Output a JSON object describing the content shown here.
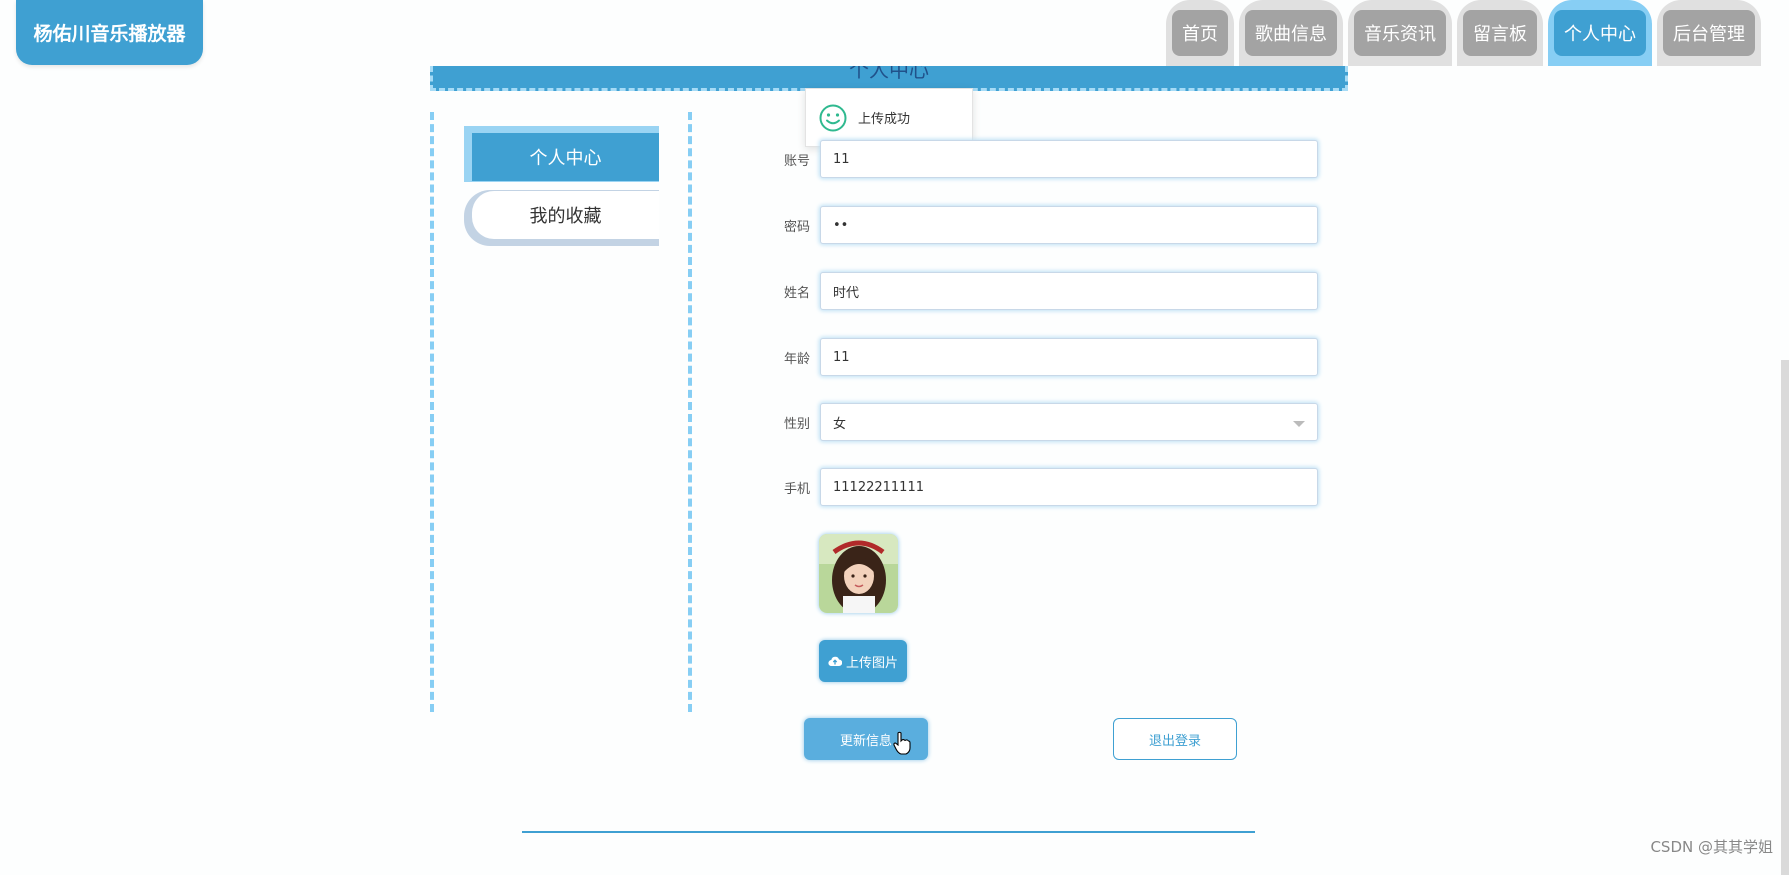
{
  "app": {
    "title": "杨佑川音乐播放器"
  },
  "nav": {
    "items": [
      {
        "label": "首页"
      },
      {
        "label": "歌曲信息"
      },
      {
        "label": "音乐资讯"
      },
      {
        "label": "留言板"
      },
      {
        "label": "个人中心",
        "active": true
      },
      {
        "label": "后台管理"
      }
    ]
  },
  "page": {
    "title": "个人中心"
  },
  "sidebar": {
    "items": [
      {
        "label": "个人中心",
        "active": true
      },
      {
        "label": "我的收藏"
      }
    ]
  },
  "toast": {
    "message": "上传成功",
    "icon": "smile-icon"
  },
  "form": {
    "account": {
      "label": "账号",
      "value": "11"
    },
    "password": {
      "label": "密码",
      "value": "••"
    },
    "name": {
      "label": "姓名",
      "value": "时代"
    },
    "age": {
      "label": "年龄",
      "value": "11"
    },
    "gender": {
      "label": "性别",
      "value": "女"
    },
    "phone": {
      "label": "手机",
      "value": "11122211111"
    }
  },
  "buttons": {
    "upload": "上传图片",
    "update": "更新信息",
    "logout": "退出登录"
  },
  "watermark": "CSDN @其其学姐",
  "colors": {
    "accent": "#3fa0d2",
    "accent_light": "#87cef4",
    "nav_inactive": "#a3a3a3"
  }
}
